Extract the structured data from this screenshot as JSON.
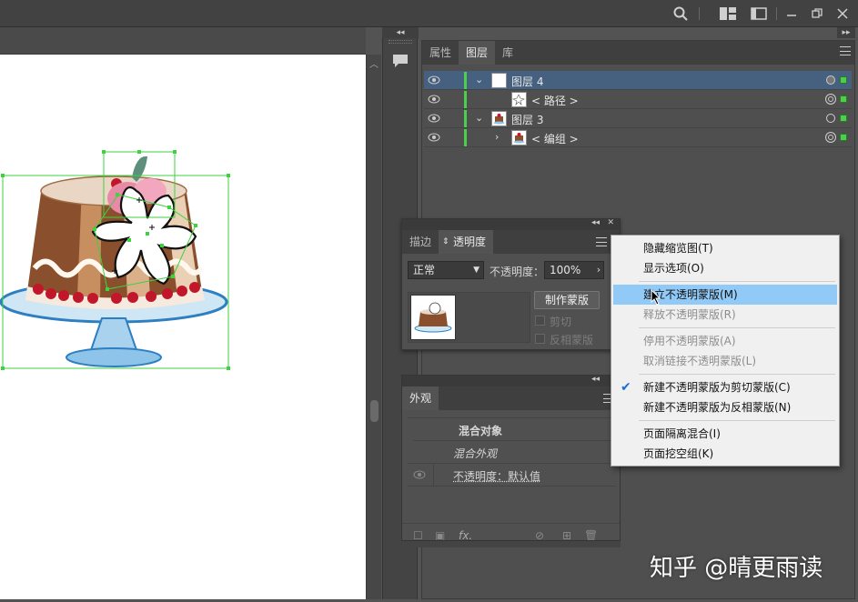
{
  "top_bar": {
    "icons": [
      "search-icon",
      "workspace-grid-icon",
      "panel-toggle-icon",
      "minimize-icon",
      "restore-icon",
      "close-icon"
    ]
  },
  "layers_panel": {
    "tabs": [
      {
        "label": "属性",
        "active": false
      },
      {
        "label": "图层",
        "active": true
      },
      {
        "label": "库",
        "active": false
      }
    ],
    "rows": [
      {
        "name": "图层 4",
        "expanded": true,
        "selected": true
      },
      {
        "name": "< 路径 >",
        "expanded": null,
        "selected": false
      },
      {
        "name": "图层 3",
        "expanded": true,
        "selected": false
      },
      {
        "name": "< 编组 >",
        "expanded": false,
        "selected": false
      }
    ]
  },
  "transparency_panel": {
    "tabs": [
      {
        "label": "描边",
        "active": false
      },
      {
        "label": "透明度",
        "active": true
      }
    ],
    "blend_mode": "正常",
    "opacity_label": "不透明度：",
    "opacity_value": "100%",
    "make_mask_button": "制作蒙版",
    "clip_label": "剪切",
    "invert_mask_label": "反相蒙版"
  },
  "appearance_panel": {
    "tab": "外观",
    "rows": [
      {
        "label": "混合对象",
        "style": "bold"
      },
      {
        "label": "混合外观",
        "style": "italic"
      },
      {
        "label": "不透明度：默认值",
        "style": "normal"
      }
    ],
    "fx_label": "fx."
  },
  "context_menu": {
    "items": [
      {
        "label": "隐藏缩览图(T)",
        "enabled": true,
        "checked": false
      },
      {
        "label": "显示选项(O)",
        "enabled": true,
        "checked": false
      },
      {
        "separator": true
      },
      {
        "label": "建立不透明蒙版(M)",
        "enabled": true,
        "checked": false,
        "hover": true
      },
      {
        "label": "释放不透明蒙版(R)",
        "enabled": false,
        "checked": false
      },
      {
        "separator": true
      },
      {
        "label": "停用不透明蒙版(A)",
        "enabled": false,
        "checked": false
      },
      {
        "label": "取消链接不透明蒙版(L)",
        "enabled": false,
        "checked": false
      },
      {
        "separator": true
      },
      {
        "label": "新建不透明蒙版为剪切蒙版(C)",
        "enabled": true,
        "checked": true
      },
      {
        "label": "新建不透明蒙版为反相蒙版(N)",
        "enabled": true,
        "checked": false
      },
      {
        "separator": true
      },
      {
        "label": "页面隔离混合(I)",
        "enabled": true,
        "checked": false
      },
      {
        "label": "页面挖空组(K)",
        "enabled": true,
        "checked": false
      }
    ]
  },
  "watermark": "知乎 @晴更雨读",
  "colors": {
    "layer_color": "#4cd04c",
    "selection_row": "#46607f",
    "menu_hover": "#91c9f7",
    "selection_bbox": "#3fd23f"
  }
}
